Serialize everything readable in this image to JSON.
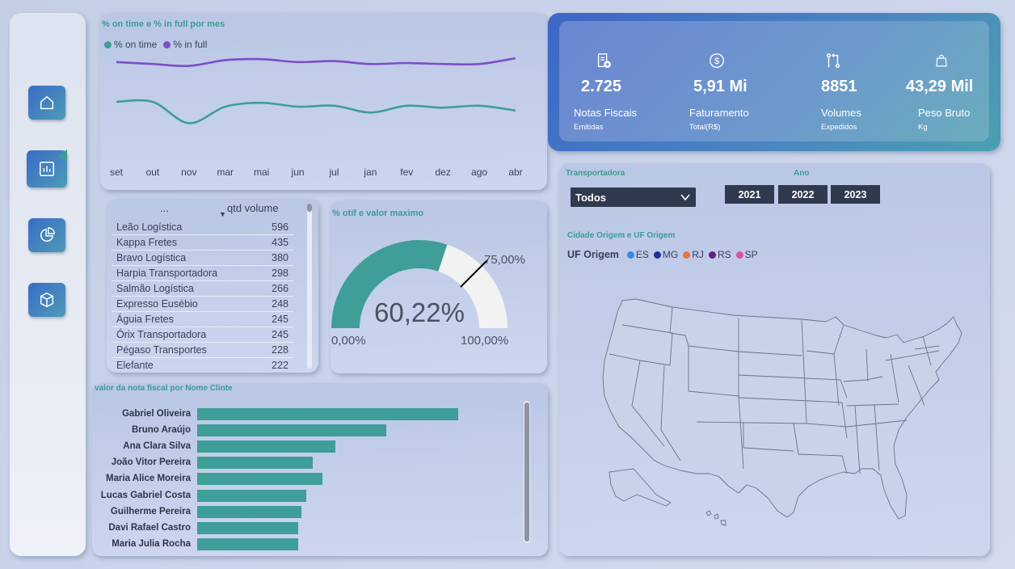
{
  "nav": {
    "items": [
      {
        "icon": "home-icon"
      },
      {
        "icon": "report-chart-icon",
        "active": true
      },
      {
        "icon": "pie-chart-icon"
      },
      {
        "icon": "box-icon"
      }
    ]
  },
  "line_chart": {
    "title": "% on time e % in full por mes",
    "legend": [
      {
        "label": "% on time",
        "color": "#3f9e97"
      },
      {
        "label": "% in full",
        "color": "#7b4fc5"
      }
    ],
    "chart_data": {
      "type": "line",
      "title": "% on time e % in full por mes",
      "categories": [
        "set",
        "out",
        "nov",
        "mar",
        "mai",
        "jun",
        "jul",
        "jan",
        "fev",
        "dez",
        "ago",
        "abr"
      ],
      "series": [
        {
          "name": "% in full",
          "color": "#7b4fc5",
          "values": [
            0.91,
            0.89,
            0.87,
            0.93,
            0.94,
            0.91,
            0.92,
            0.89,
            0.9,
            0.89,
            0.89,
            0.95
          ]
        },
        {
          "name": "% on time",
          "color": "#3f9e97",
          "values": [
            0.5,
            0.5,
            0.28,
            0.45,
            0.49,
            0.45,
            0.46,
            0.39,
            0.46,
            0.44,
            0.46,
            0.41
          ]
        }
      ],
      "ylim": [
        0,
        1
      ],
      "grid": false,
      "legend_position": "top-left"
    }
  },
  "table": {
    "col1": "...",
    "col2": "qtd volume",
    "rows": [
      {
        "name": "Leão Logística",
        "value": "596"
      },
      {
        "name": "Kappa Fretes",
        "value": "435"
      },
      {
        "name": "Bravo Logística",
        "value": "380"
      },
      {
        "name": "Harpia Transportadora",
        "value": "298"
      },
      {
        "name": "Salmão Logística",
        "value": "266"
      },
      {
        "name": "Expresso Eusébio",
        "value": "248"
      },
      {
        "name": "Águia Fretes",
        "value": "245"
      },
      {
        "name": "Órix Transportadora",
        "value": "245"
      },
      {
        "name": "Pégaso Transportes",
        "value": "228"
      },
      {
        "name": "Elefante",
        "value": "222"
      }
    ]
  },
  "gauge": {
    "title": "% otif e valor maximo",
    "value_label": "60,22%",
    "min_label": "0,00%",
    "max_label": "100,00%",
    "target_label": "75,00%",
    "value": 0.6022,
    "target": 0.75,
    "fill_color": "#3f9e97",
    "track_color": "#f2f2f2"
  },
  "bar_chart": {
    "title": "valor da nota fiscal por Nome Clinte",
    "chart_data": {
      "type": "bar",
      "title": "valor da nota fiscal por Nome Clinte",
      "categories": [
        "Gabriel Oliveira",
        "Bruno Araújo",
        "Ana Clara Silva",
        "João Vitor Pereira",
        "Maria Alice Moreira",
        "Lucas Gabriel Costa",
        "Guilherme Pereira",
        "Davi Rafael Castro",
        "Maria Julia Rocha"
      ],
      "values": [
        100,
        72.5,
        52.9,
        44.3,
        48.0,
        41.8,
        40.0,
        38.8,
        38.8
      ],
      "color": "#3f9e97",
      "orientation": "horizontal"
    }
  },
  "kpis": [
    {
      "icon": "invoice-icon",
      "value": "2.725",
      "label": "Notas Fiscais",
      "sub": "Emitidas"
    },
    {
      "icon": "dollar-icon",
      "value": "5,91 Mi",
      "label": "Faturamento",
      "sub": "Total(R$)"
    },
    {
      "icon": "transfer-icon",
      "value": "8851",
      "label": "Volumes",
      "sub": "Expedidos"
    },
    {
      "icon": "bag-icon",
      "value": "43,29 Mil",
      "label": "Peso Bruto",
      "sub": "Kg"
    }
  ],
  "filters": {
    "carrier_title": "Transportadora",
    "carrier_value": "Todos",
    "year_title": "Ano",
    "years": [
      "2021",
      "2022",
      "2023"
    ]
  },
  "map": {
    "title": "Cidade Origem e UF Origem",
    "legend_title": "UF Origem",
    "legend": [
      {
        "label": "ES",
        "color": "#2e8de6"
      },
      {
        "label": "MG",
        "color": "#1e2f9a"
      },
      {
        "label": "RJ",
        "color": "#e6733a"
      },
      {
        "label": "RS",
        "color": "#6a1b8a"
      },
      {
        "label": "SP",
        "color": "#e04fa8"
      }
    ]
  }
}
